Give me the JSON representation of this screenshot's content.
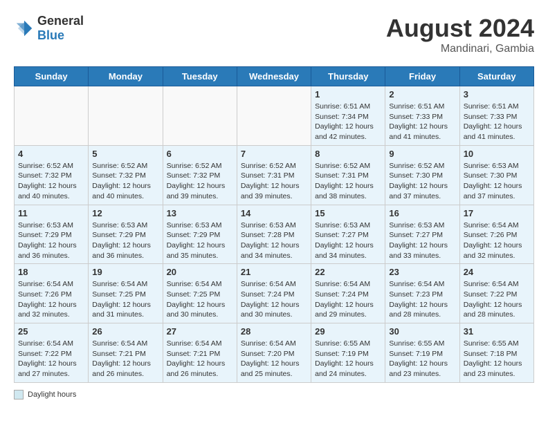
{
  "header": {
    "logo_general": "General",
    "logo_blue": "Blue",
    "month_year": "August 2024",
    "location": "Mandinari, Gambia"
  },
  "weekdays": [
    "Sunday",
    "Monday",
    "Tuesday",
    "Wednesday",
    "Thursday",
    "Friday",
    "Saturday"
  ],
  "footer": {
    "label": "Daylight hours"
  },
  "weeks": [
    [
      {
        "day": "",
        "sunrise": "",
        "sunset": "",
        "daylight": "",
        "empty": true
      },
      {
        "day": "",
        "sunrise": "",
        "sunset": "",
        "daylight": "",
        "empty": true
      },
      {
        "day": "",
        "sunrise": "",
        "sunset": "",
        "daylight": "",
        "empty": true
      },
      {
        "day": "",
        "sunrise": "",
        "sunset": "",
        "daylight": "",
        "empty": true
      },
      {
        "day": "1",
        "sunrise": "Sunrise: 6:51 AM",
        "sunset": "Sunset: 7:34 PM",
        "daylight": "Daylight: 12 hours and 42 minutes.",
        "empty": false
      },
      {
        "day": "2",
        "sunrise": "Sunrise: 6:51 AM",
        "sunset": "Sunset: 7:33 PM",
        "daylight": "Daylight: 12 hours and 41 minutes.",
        "empty": false
      },
      {
        "day": "3",
        "sunrise": "Sunrise: 6:51 AM",
        "sunset": "Sunset: 7:33 PM",
        "daylight": "Daylight: 12 hours and 41 minutes.",
        "empty": false
      }
    ],
    [
      {
        "day": "4",
        "sunrise": "Sunrise: 6:52 AM",
        "sunset": "Sunset: 7:32 PM",
        "daylight": "Daylight: 12 hours and 40 minutes.",
        "empty": false
      },
      {
        "day": "5",
        "sunrise": "Sunrise: 6:52 AM",
        "sunset": "Sunset: 7:32 PM",
        "daylight": "Daylight: 12 hours and 40 minutes.",
        "empty": false
      },
      {
        "day": "6",
        "sunrise": "Sunrise: 6:52 AM",
        "sunset": "Sunset: 7:32 PM",
        "daylight": "Daylight: 12 hours and 39 minutes.",
        "empty": false
      },
      {
        "day": "7",
        "sunrise": "Sunrise: 6:52 AM",
        "sunset": "Sunset: 7:31 PM",
        "daylight": "Daylight: 12 hours and 39 minutes.",
        "empty": false
      },
      {
        "day": "8",
        "sunrise": "Sunrise: 6:52 AM",
        "sunset": "Sunset: 7:31 PM",
        "daylight": "Daylight: 12 hours and 38 minutes.",
        "empty": false
      },
      {
        "day": "9",
        "sunrise": "Sunrise: 6:52 AM",
        "sunset": "Sunset: 7:30 PM",
        "daylight": "Daylight: 12 hours and 37 minutes.",
        "empty": false
      },
      {
        "day": "10",
        "sunrise": "Sunrise: 6:53 AM",
        "sunset": "Sunset: 7:30 PM",
        "daylight": "Daylight: 12 hours and 37 minutes.",
        "empty": false
      }
    ],
    [
      {
        "day": "11",
        "sunrise": "Sunrise: 6:53 AM",
        "sunset": "Sunset: 7:29 PM",
        "daylight": "Daylight: 12 hours and 36 minutes.",
        "empty": false
      },
      {
        "day": "12",
        "sunrise": "Sunrise: 6:53 AM",
        "sunset": "Sunset: 7:29 PM",
        "daylight": "Daylight: 12 hours and 36 minutes.",
        "empty": false
      },
      {
        "day": "13",
        "sunrise": "Sunrise: 6:53 AM",
        "sunset": "Sunset: 7:29 PM",
        "daylight": "Daylight: 12 hours and 35 minutes.",
        "empty": false
      },
      {
        "day": "14",
        "sunrise": "Sunrise: 6:53 AM",
        "sunset": "Sunset: 7:28 PM",
        "daylight": "Daylight: 12 hours and 34 minutes.",
        "empty": false
      },
      {
        "day": "15",
        "sunrise": "Sunrise: 6:53 AM",
        "sunset": "Sunset: 7:27 PM",
        "daylight": "Daylight: 12 hours and 34 minutes.",
        "empty": false
      },
      {
        "day": "16",
        "sunrise": "Sunrise: 6:53 AM",
        "sunset": "Sunset: 7:27 PM",
        "daylight": "Daylight: 12 hours and 33 minutes.",
        "empty": false
      },
      {
        "day": "17",
        "sunrise": "Sunrise: 6:54 AM",
        "sunset": "Sunset: 7:26 PM",
        "daylight": "Daylight: 12 hours and 32 minutes.",
        "empty": false
      }
    ],
    [
      {
        "day": "18",
        "sunrise": "Sunrise: 6:54 AM",
        "sunset": "Sunset: 7:26 PM",
        "daylight": "Daylight: 12 hours and 32 minutes.",
        "empty": false
      },
      {
        "day": "19",
        "sunrise": "Sunrise: 6:54 AM",
        "sunset": "Sunset: 7:25 PM",
        "daylight": "Daylight: 12 hours and 31 minutes.",
        "empty": false
      },
      {
        "day": "20",
        "sunrise": "Sunrise: 6:54 AM",
        "sunset": "Sunset: 7:25 PM",
        "daylight": "Daylight: 12 hours and 30 minutes.",
        "empty": false
      },
      {
        "day": "21",
        "sunrise": "Sunrise: 6:54 AM",
        "sunset": "Sunset: 7:24 PM",
        "daylight": "Daylight: 12 hours and 30 minutes.",
        "empty": false
      },
      {
        "day": "22",
        "sunrise": "Sunrise: 6:54 AM",
        "sunset": "Sunset: 7:24 PM",
        "daylight": "Daylight: 12 hours and 29 minutes.",
        "empty": false
      },
      {
        "day": "23",
        "sunrise": "Sunrise: 6:54 AM",
        "sunset": "Sunset: 7:23 PM",
        "daylight": "Daylight: 12 hours and 28 minutes.",
        "empty": false
      },
      {
        "day": "24",
        "sunrise": "Sunrise: 6:54 AM",
        "sunset": "Sunset: 7:22 PM",
        "daylight": "Daylight: 12 hours and 28 minutes.",
        "empty": false
      }
    ],
    [
      {
        "day": "25",
        "sunrise": "Sunrise: 6:54 AM",
        "sunset": "Sunset: 7:22 PM",
        "daylight": "Daylight: 12 hours and 27 minutes.",
        "empty": false
      },
      {
        "day": "26",
        "sunrise": "Sunrise: 6:54 AM",
        "sunset": "Sunset: 7:21 PM",
        "daylight": "Daylight: 12 hours and 26 minutes.",
        "empty": false
      },
      {
        "day": "27",
        "sunrise": "Sunrise: 6:54 AM",
        "sunset": "Sunset: 7:21 PM",
        "daylight": "Daylight: 12 hours and 26 minutes.",
        "empty": false
      },
      {
        "day": "28",
        "sunrise": "Sunrise: 6:54 AM",
        "sunset": "Sunset: 7:20 PM",
        "daylight": "Daylight: 12 hours and 25 minutes.",
        "empty": false
      },
      {
        "day": "29",
        "sunrise": "Sunrise: 6:55 AM",
        "sunset": "Sunset: 7:19 PM",
        "daylight": "Daylight: 12 hours and 24 minutes.",
        "empty": false
      },
      {
        "day": "30",
        "sunrise": "Sunrise: 6:55 AM",
        "sunset": "Sunset: 7:19 PM",
        "daylight": "Daylight: 12 hours and 23 minutes.",
        "empty": false
      },
      {
        "day": "31",
        "sunrise": "Sunrise: 6:55 AM",
        "sunset": "Sunset: 7:18 PM",
        "daylight": "Daylight: 12 hours and 23 minutes.",
        "empty": false
      }
    ]
  ]
}
